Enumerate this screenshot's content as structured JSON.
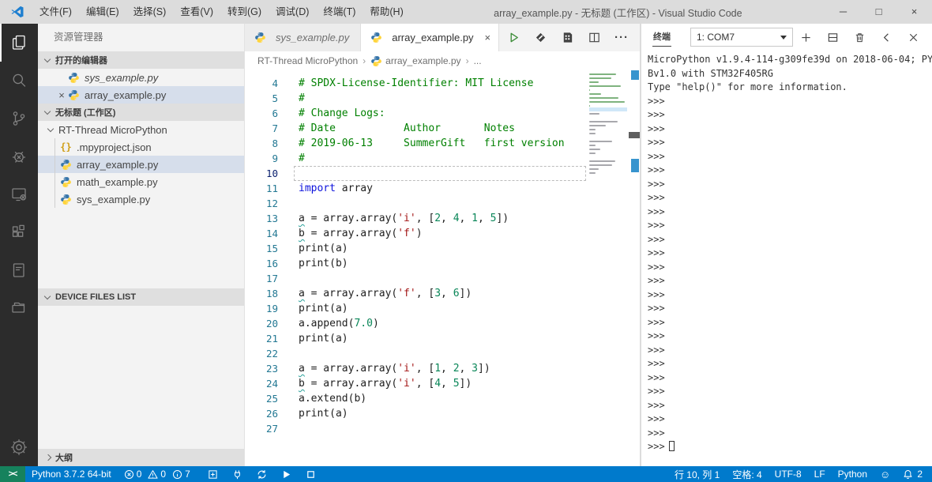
{
  "window": {
    "title": "array_example.py - 无标题 (工作区) - Visual Studio Code",
    "menus": [
      "文件(F)",
      "编辑(E)",
      "选择(S)",
      "查看(V)",
      "转到(G)",
      "调试(D)",
      "终端(T)",
      "帮助(H)"
    ],
    "controls": {
      "minimize": "─",
      "maximize": "□",
      "close": "×"
    }
  },
  "activity_bar": {
    "top": [
      {
        "name": "explorer-icon",
        "active": true
      },
      {
        "name": "search-icon",
        "active": false
      },
      {
        "name": "source-control-icon",
        "active": false
      },
      {
        "name": "debug-icon",
        "active": false
      },
      {
        "name": "device-connection-icon",
        "active": false
      },
      {
        "name": "extensions-icon",
        "active": false
      },
      {
        "name": "notebook-icon",
        "active": false
      },
      {
        "name": "folder-library-icon",
        "active": false
      }
    ],
    "bottom": [
      {
        "name": "settings-gear-icon",
        "active": false
      }
    ]
  },
  "sidebar": {
    "title": "资源管理器",
    "open_editors": {
      "header": "打开的编辑器",
      "items": [
        {
          "label": "sys_example.py",
          "icon": "python-icon",
          "preview": true,
          "selected": false,
          "close": false
        },
        {
          "label": "array_example.py",
          "icon": "python-icon",
          "preview": false,
          "selected": true,
          "close": true
        }
      ]
    },
    "workspace": {
      "header": "无标题 (工作区)",
      "folder": "RT-Thread MicroPython",
      "files": [
        {
          "label": ".mpyproject.json",
          "icon": "json-icon",
          "selected": false
        },
        {
          "label": "array_example.py",
          "icon": "python-icon",
          "selected": true
        },
        {
          "label": "math_example.py",
          "icon": "python-icon",
          "selected": false
        },
        {
          "label": "sys_example.py",
          "icon": "python-icon",
          "selected": false
        }
      ]
    },
    "device_files_header": "DEVICE FILES LIST",
    "outline_header": "大纲"
  },
  "editor": {
    "tabs": [
      {
        "label": "sys_example.py",
        "icon": "python-icon",
        "active": false,
        "preview": true,
        "close": false
      },
      {
        "label": "array_example.py",
        "icon": "python-icon",
        "active": true,
        "preview": false,
        "close": true
      }
    ],
    "toolbar": [
      {
        "name": "run-python-file-icon"
      },
      {
        "name": "micropython-run-icon"
      },
      {
        "name": "memory-chip-icon"
      },
      {
        "name": "split-editor-icon"
      },
      {
        "name": "more-actions-icon"
      }
    ],
    "breadcrumb": [
      "RT-Thread MicroPython",
      "array_example.py",
      "..."
    ],
    "code_lines": [
      {
        "n": 4,
        "t": [
          [
            "c",
            "# SPDX-License-Identifier: MIT License"
          ]
        ]
      },
      {
        "n": 5,
        "t": [
          [
            "c",
            "#"
          ]
        ]
      },
      {
        "n": 6,
        "t": [
          [
            "c",
            "# Change Logs:"
          ]
        ]
      },
      {
        "n": 7,
        "t": [
          [
            "c",
            "# Date           Author       Notes"
          ]
        ]
      },
      {
        "n": 8,
        "t": [
          [
            "c",
            "# 2019-06-13     SummerGift   first version"
          ]
        ]
      },
      {
        "n": 9,
        "t": [
          [
            "c",
            "#"
          ]
        ]
      },
      {
        "n": 10,
        "t": [],
        "current": true
      },
      {
        "n": 11,
        "t": [
          [
            "k",
            "import"
          ],
          [
            "x",
            " array"
          ]
        ]
      },
      {
        "n": 12,
        "t": []
      },
      {
        "n": 13,
        "t": [
          [
            "v",
            "a"
          ],
          [
            "x",
            " = array.array("
          ],
          [
            "s",
            "'i'"
          ],
          [
            "x",
            ", ["
          ],
          [
            "m",
            "2"
          ],
          [
            "x",
            ", "
          ],
          [
            "m",
            "4"
          ],
          [
            "x",
            ", "
          ],
          [
            "m",
            "1"
          ],
          [
            "x",
            ", "
          ],
          [
            "m",
            "5"
          ],
          [
            "x",
            "])"
          ]
        ]
      },
      {
        "n": 14,
        "t": [
          [
            "v",
            "b"
          ],
          [
            "x",
            " = array.array("
          ],
          [
            "s",
            "'f'"
          ],
          [
            "x",
            ")"
          ]
        ]
      },
      {
        "n": 15,
        "t": [
          [
            "x",
            "print(a)"
          ]
        ]
      },
      {
        "n": 16,
        "t": [
          [
            "x",
            "print(b)"
          ]
        ]
      },
      {
        "n": 17,
        "t": []
      },
      {
        "n": 18,
        "t": [
          [
            "v",
            "a"
          ],
          [
            "x",
            " = array.array("
          ],
          [
            "s",
            "'f'"
          ],
          [
            "x",
            ", ["
          ],
          [
            "m",
            "3"
          ],
          [
            "x",
            ", "
          ],
          [
            "m",
            "6"
          ],
          [
            "x",
            "])"
          ]
        ]
      },
      {
        "n": 19,
        "t": [
          [
            "x",
            "print(a)"
          ]
        ]
      },
      {
        "n": 20,
        "t": [
          [
            "x",
            "a.append("
          ],
          [
            "m",
            "7.0"
          ],
          [
            "x",
            ")"
          ]
        ]
      },
      {
        "n": 21,
        "t": [
          [
            "x",
            "print(a)"
          ]
        ]
      },
      {
        "n": 22,
        "t": []
      },
      {
        "n": 23,
        "t": [
          [
            "v",
            "a"
          ],
          [
            "x",
            " = array.array("
          ],
          [
            "s",
            "'i'"
          ],
          [
            "x",
            ", ["
          ],
          [
            "m",
            "1"
          ],
          [
            "x",
            ", "
          ],
          [
            "m",
            "2"
          ],
          [
            "x",
            ", "
          ],
          [
            "m",
            "3"
          ],
          [
            "x",
            "])"
          ]
        ]
      },
      {
        "n": 24,
        "t": [
          [
            "v",
            "b"
          ],
          [
            "x",
            " = array.array("
          ],
          [
            "s",
            "'i'"
          ],
          [
            "x",
            ", ["
          ],
          [
            "m",
            "4"
          ],
          [
            "x",
            ", "
          ],
          [
            "m",
            "5"
          ],
          [
            "x",
            "])"
          ]
        ]
      },
      {
        "n": 25,
        "t": [
          [
            "x",
            "a.extend(b)"
          ]
        ]
      },
      {
        "n": 26,
        "t": [
          [
            "x",
            "print(a)"
          ]
        ]
      },
      {
        "n": 27,
        "t": []
      }
    ]
  },
  "terminal": {
    "tab_label": "终端",
    "port_selector": "1: COM7",
    "actions": [
      {
        "name": "new-terminal-icon"
      },
      {
        "name": "split-terminal-icon"
      },
      {
        "name": "kill-terminal-icon"
      },
      {
        "name": "collapse-panel-icon"
      },
      {
        "name": "close-panel-icon"
      }
    ],
    "output_lines": [
      "MicroPython v1.9.4-114-g309fe39d on 2018-06-04; PY",
      "Bv1.0 with STM32F405RG",
      "Type \"help()\" for more information."
    ],
    "prompt": ">>>",
    "prompt_count": 26
  },
  "status_bar": {
    "remote_indicator": "><",
    "interpreter": "Python 3.7.2 64-bit",
    "problems": {
      "errors": "0",
      "warnings": "0",
      "infos": "7"
    },
    "left_icons": [
      {
        "name": "board-new-icon"
      },
      {
        "name": "usb-connect-icon"
      },
      {
        "name": "sync-icon"
      },
      {
        "name": "run-icon"
      },
      {
        "name": "stop-icon"
      }
    ],
    "cursor_position": "行 10, 列 1",
    "indentation": "空格: 4",
    "encoding": "UTF-8",
    "eol": "LF",
    "language": "Python",
    "notifications_count": "2"
  },
  "colors": {
    "accent": "#007acc",
    "remote_green": "#16825d",
    "titlebar": "#dcdcdc",
    "activitybar": "#2c2c2c",
    "sidebar": "#f3f3f3",
    "selection": "#d6deeb",
    "comment": "#008000",
    "keyword": "#0d12dc",
    "string": "#a31515",
    "number": "#098658"
  }
}
